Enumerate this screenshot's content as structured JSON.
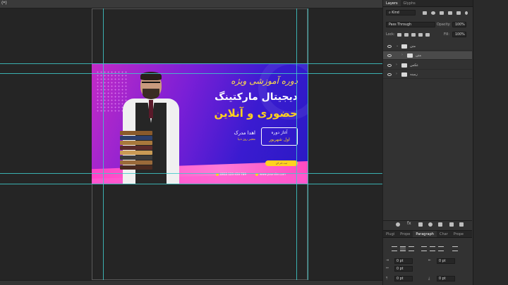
{
  "document": {
    "tab_label": "(*)",
    "zoom": ""
  },
  "banner": {
    "title_line1": "دوره آموزشی ویژه",
    "title_line2": "دیجیتال مارکتینگ",
    "title_line3": "حضوری و آنلاین",
    "start_label": "آغاز دوره",
    "start_date": "اول شهریور",
    "cert_label": "اهدا مدرک",
    "cert_sub": "معتبر روز دنیا",
    "pill_text": "ثبت نام کن",
    "phone": "0912 123 456 789",
    "website": "www.yoursite.com"
  },
  "layers_panel": {
    "tabs": [
      "Layers",
      "Glyphs"
    ],
    "filter_kind": "Kind",
    "blend_mode": "Pass Through",
    "opacity_label": "Opacity:",
    "opacity_value": "100%",
    "lock_label": "Lock:",
    "fill_label": "Fill:",
    "fill_value": "100%",
    "layers": [
      {
        "name": "متن",
        "expanded": true,
        "selected": false,
        "indent": 0
      },
      {
        "name": "متن",
        "expanded": false,
        "selected": true,
        "indent": 1
      },
      {
        "name": "عکس",
        "expanded": false,
        "selected": false,
        "indent": 0
      },
      {
        "name": "زمینه",
        "expanded": false,
        "selected": false,
        "indent": 0
      }
    ]
  },
  "paragraph_panel": {
    "tabs": [
      "Plugi",
      "Prope",
      "Paragraph",
      "Char",
      "Prope"
    ],
    "active_tab": "Paragraph",
    "indent_left": "0 pt",
    "indent_right": "0 pt",
    "indent_first": "0 pt",
    "space_before": "0 pt",
    "space_after": "0 pt"
  },
  "colors": {
    "accent_guide": "#3fc9c9",
    "brand_yellow": "#ffd21f",
    "brand_pink": "#ff43c7",
    "brand_purple": "#3a1bd0"
  }
}
